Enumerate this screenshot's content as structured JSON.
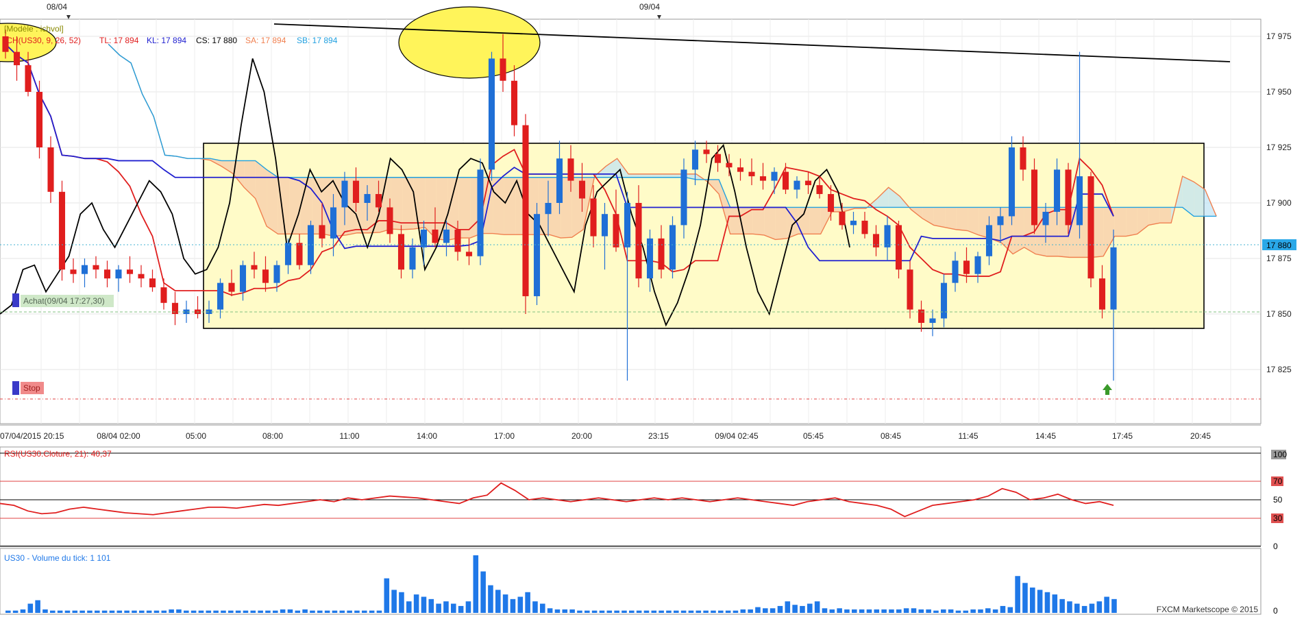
{
  "top_date_markers": [
    "08/04",
    "09/04"
  ],
  "legend": {
    "model": "[Modèle : ichvol]",
    "ich": "ICH(US30, 9, 26, 52)",
    "tl": "TL: 17 894",
    "kl": "KL: 17 894",
    "cs": "CS: 17 880",
    "sa": "SA: 17 894",
    "sb": "SB: 17 894"
  },
  "annotations": {
    "buy": "Achat(09/04 17:27,30)",
    "stop": "Stop"
  },
  "price_axis": {
    "ticks": [
      "17 975",
      "17 950",
      "17 925",
      "17 900",
      "17 875",
      "17 850",
      "17 825"
    ],
    "current": "17 880"
  },
  "time_axis": [
    "07/04/2015 20:15",
    "08/04 02:00",
    "05:00",
    "08:00",
    "11:00",
    "14:00",
    "17:00",
    "20:00",
    "23:15",
    "09/04 02:45",
    "05:45",
    "08:45",
    "11:45",
    "14:45",
    "17:45",
    "20:45"
  ],
  "rsi": {
    "label": "RSI(US30.Cloture, 21): 40,37",
    "ticks": [
      "100",
      "70",
      "50",
      "30",
      "0"
    ]
  },
  "volume": {
    "label": "US30 - Volume du tick: 1 101",
    "ticks": [
      "0"
    ]
  },
  "watermark": "FXCM Marketscope © 2015",
  "colors": {
    "up": "#1f6fd6",
    "down": "#e01e1e",
    "tenkan": "#e01e1e",
    "kijun": "#2020d0",
    "chikou": "#000000",
    "senkou_a": "#f08050",
    "senkou_b": "#20a0e0",
    "box": "#fffbc8",
    "rsi": "#e01e1e",
    "volume": "#1f78e8"
  },
  "chart_data": {
    "type": "candlestick",
    "symbol": "US30",
    "price_ylim": [
      17805,
      17985
    ],
    "candles_ohlc": [
      [
        17975,
        17978,
        17965,
        17968
      ],
      [
        17968,
        17975,
        17955,
        17962
      ],
      [
        17962,
        17968,
        17948,
        17950
      ],
      [
        17950,
        17955,
        17920,
        17925
      ],
      [
        17925,
        17930,
        17900,
        17905
      ],
      [
        17905,
        17910,
        17865,
        17870
      ],
      [
        17870,
        17875,
        17864,
        17868
      ],
      [
        17868,
        17875,
        17862,
        17872
      ],
      [
        17872,
        17876,
        17866,
        17870
      ],
      [
        17870,
        17874,
        17862,
        17866
      ],
      [
        17866,
        17872,
        17860,
        17870
      ],
      [
        17870,
        17876,
        17864,
        17868
      ],
      [
        17868,
        17872,
        17862,
        17866
      ],
      [
        17866,
        17870,
        17860,
        17862
      ],
      [
        17862,
        17866,
        17852,
        17855
      ],
      [
        17855,
        17860,
        17845,
        17850
      ],
      [
        17850,
        17856,
        17846,
        17852
      ],
      [
        17852,
        17858,
        17848,
        17850
      ],
      [
        17850,
        17856,
        17846,
        17852
      ],
      [
        17852,
        17866,
        17848,
        17864
      ],
      [
        17864,
        17870,
        17858,
        17860
      ],
      [
        17860,
        17874,
        17856,
        17872
      ],
      [
        17872,
        17878,
        17866,
        17870
      ],
      [
        17870,
        17876,
        17860,
        17864
      ],
      [
        17864,
        17874,
        17860,
        17872
      ],
      [
        17872,
        17884,
        17868,
        17882
      ],
      [
        17882,
        17886,
        17870,
        17872
      ],
      [
        17872,
        17892,
        17868,
        17890
      ],
      [
        17890,
        17900,
        17880,
        17884
      ],
      [
        17884,
        17904,
        17876,
        17898
      ],
      [
        17898,
        17914,
        17890,
        17910
      ],
      [
        17910,
        17916,
        17896,
        17900
      ],
      [
        17900,
        17908,
        17892,
        17904
      ],
      [
        17904,
        17910,
        17896,
        17898
      ],
      [
        17898,
        17902,
        17882,
        17886
      ],
      [
        17886,
        17890,
        17866,
        17870
      ],
      [
        17870,
        17884,
        17866,
        17880
      ],
      [
        17880,
        17892,
        17872,
        17888
      ],
      [
        17888,
        17898,
        17880,
        17882
      ],
      [
        17882,
        17892,
        17876,
        17888
      ],
      [
        17888,
        17892,
        17874,
        17878
      ],
      [
        17878,
        17884,
        17872,
        17876
      ],
      [
        17876,
        17920,
        17872,
        17915
      ],
      [
        17915,
        17968,
        17910,
        17965
      ],
      [
        17965,
        17976,
        17950,
        17955
      ],
      [
        17955,
        17962,
        17930,
        17935
      ],
      [
        17935,
        17940,
        17850,
        17858
      ],
      [
        17858,
        17900,
        17854,
        17895
      ],
      [
        17895,
        17910,
        17885,
        17900
      ],
      [
        17900,
        17928,
        17895,
        17920
      ],
      [
        17920,
        17926,
        17905,
        17910
      ],
      [
        17910,
        17918,
        17896,
        17902
      ],
      [
        17902,
        17908,
        17880,
        17885
      ],
      [
        17885,
        17900,
        17870,
        17895
      ],
      [
        17895,
        17906,
        17878,
        17880
      ],
      [
        17880,
        17905,
        17820,
        17900
      ],
      [
        17900,
        17908,
        17862,
        17866
      ],
      [
        17866,
        17888,
        17860,
        17884
      ],
      [
        17884,
        17890,
        17866,
        17870
      ],
      [
        17870,
        17894,
        17866,
        17890
      ],
      [
        17890,
        17920,
        17884,
        17915
      ],
      [
        17915,
        17928,
        17908,
        17924
      ],
      [
        17924,
        17928,
        17918,
        17922
      ],
      [
        17922,
        17926,
        17914,
        17918
      ],
      [
        17918,
        17922,
        17912,
        17916
      ],
      [
        17916,
        17920,
        17910,
        17914
      ],
      [
        17914,
        17920,
        17908,
        17912
      ],
      [
        17912,
        17918,
        17906,
        17910
      ],
      [
        17910,
        17916,
        17904,
        17914
      ],
      [
        17914,
        17918,
        17904,
        17906
      ],
      [
        17906,
        17912,
        17902,
        17910
      ],
      [
        17910,
        17914,
        17904,
        17908
      ],
      [
        17908,
        17912,
        17902,
        17904
      ],
      [
        17904,
        17908,
        17892,
        17896
      ],
      [
        17896,
        17900,
        17888,
        17890
      ],
      [
        17890,
        17896,
        17886,
        17892
      ],
      [
        17892,
        17896,
        17884,
        17886
      ],
      [
        17886,
        17890,
        17876,
        17880
      ],
      [
        17880,
        17894,
        17874,
        17890
      ],
      [
        17890,
        17892,
        17866,
        17870
      ],
      [
        17870,
        17874,
        17848,
        17852
      ],
      [
        17852,
        17856,
        17842,
        17846
      ],
      [
        17846,
        17852,
        17840,
        17848
      ],
      [
        17848,
        17868,
        17844,
        17864
      ],
      [
        17864,
        17878,
        17860,
        17874
      ],
      [
        17874,
        17880,
        17864,
        17868
      ],
      [
        17868,
        17878,
        17864,
        17876
      ],
      [
        17876,
        17894,
        17872,
        17890
      ],
      [
        17890,
        17898,
        17882,
        17894
      ],
      [
        17894,
        17930,
        17890,
        17925
      ],
      [
        17925,
        17930,
        17910,
        17915
      ],
      [
        17915,
        17920,
        17886,
        17890
      ],
      [
        17890,
        17900,
        17882,
        17896
      ],
      [
        17896,
        17920,
        17890,
        17915
      ],
      [
        17915,
        17918,
        17886,
        17890
      ],
      [
        17890,
        17968,
        17884,
        17912
      ],
      [
        17912,
        17914,
        17862,
        17866
      ],
      [
        17866,
        17872,
        17848,
        17852
      ],
      [
        17852,
        17888,
        17820,
        17880
      ]
    ],
    "chikou_close_series": [
      17850,
      17854,
      17870,
      17872,
      17860,
      17868,
      17876,
      17895,
      17900,
      17888,
      17880,
      17890,
      17900,
      17910,
      17905,
      17895,
      17875,
      17868,
      17870,
      17880,
      17900,
      17935,
      17965,
      17950,
      17920,
      17880,
      17895,
      17915,
      17905,
      17910,
      17900,
      17895,
      17880,
      17895,
      17920,
      17915,
      17905,
      17870,
      17880,
      17895,
      17915,
      17920,
      17918,
      17905,
      17900,
      17910,
      17895,
      17890,
      17880,
      17870,
      17860,
      17890,
      17905,
      17910,
      17915,
      17895,
      17880,
      17860,
      17845,
      17855,
      17870,
      17890,
      17920,
      17926,
      17905,
      17880,
      17860,
      17850,
      17870,
      17890,
      17895,
      17910,
      17915,
      17905,
      17880
    ],
    "rsi_ylim": [
      0,
      100
    ],
    "rsi_levels": [
      70,
      50,
      30
    ],
    "rsi_values": [
      46,
      44,
      38,
      35,
      36,
      40,
      42,
      40,
      38,
      36,
      35,
      34,
      36,
      38,
      40,
      42,
      42,
      41,
      43,
      45,
      44,
      46,
      48,
      50,
      48,
      52,
      50,
      52,
      54,
      53,
      52,
      50,
      48,
      46,
      52,
      55,
      68,
      60,
      50,
      52,
      50,
      48,
      50,
      52,
      50,
      48,
      50,
      52,
      50,
      52,
      50,
      48,
      50,
      52,
      50,
      48,
      46,
      44,
      48,
      50,
      52,
      48,
      46,
      44,
      40,
      32,
      38,
      44,
      46,
      48,
      50,
      54,
      62,
      58,
      50,
      52,
      56,
      50,
      46,
      48,
      44
    ],
    "volume_bars": [
      2,
      2,
      3,
      8,
      11,
      3,
      2,
      2,
      2,
      2,
      2,
      2,
      2,
      2,
      2,
      2,
      2,
      2,
      2,
      2,
      2,
      2,
      3,
      3,
      2,
      2,
      2,
      2,
      2,
      2,
      2,
      2,
      2,
      2,
      2,
      2,
      2,
      3,
      3,
      2,
      3,
      2,
      2,
      2,
      2,
      2,
      2,
      2,
      2,
      2,
      2,
      30,
      20,
      18,
      10,
      16,
      14,
      12,
      8,
      10,
      8,
      6,
      10,
      50,
      36,
      24,
      20,
      16,
      12,
      14,
      18,
      10,
      8,
      4,
      3,
      3,
      3,
      2,
      2,
      2,
      2,
      2,
      2,
      2,
      2,
      2,
      2,
      2,
      2,
      2,
      2,
      2,
      2,
      2,
      2,
      2,
      2,
      2,
      2,
      3,
      3,
      5,
      4,
      4,
      6,
      10,
      7,
      6,
      8,
      10,
      4,
      3,
      4,
      3,
      3,
      3,
      3,
      3,
      3,
      3,
      3,
      4,
      4,
      3,
      3,
      2,
      3,
      3,
      2,
      2,
      3,
      3,
      4,
      3,
      6,
      5,
      32,
      26,
      22,
      20,
      18,
      16,
      12,
      10,
      8,
      6,
      8,
      10,
      14,
      12
    ]
  }
}
